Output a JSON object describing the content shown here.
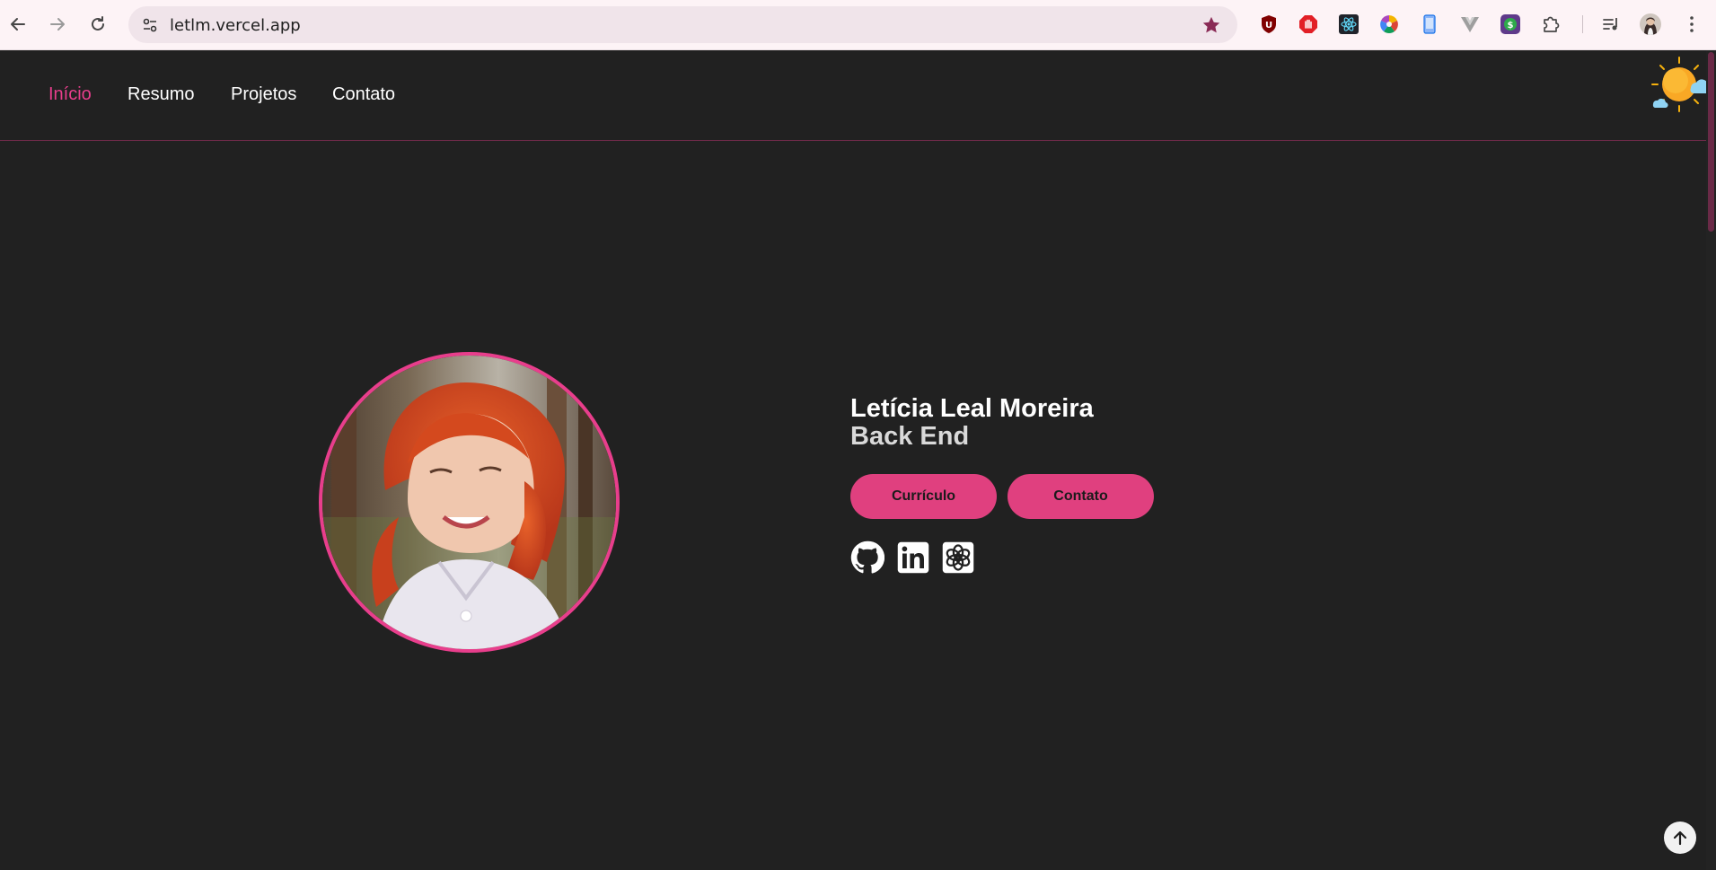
{
  "browser": {
    "url": "letlm.vercel.app",
    "icons": {
      "back": "arrow-left-icon",
      "forward": "arrow-right-icon",
      "reload": "reload-icon",
      "site_info": "tune-icon",
      "bookmark": "star-icon",
      "extensions": [
        "ublock-icon",
        "adblock-icon",
        "react-devtools-icon",
        "color-wheel-icon",
        "phone-icon",
        "vue-devtools-icon",
        "dollar-icon",
        "puzzle-icon"
      ],
      "media": "media-control-icon",
      "profile": "profile-avatar-icon",
      "menu": "kebab-menu-icon"
    }
  },
  "nav": {
    "items": [
      {
        "label": "Início",
        "active": true
      },
      {
        "label": "Resumo",
        "active": false
      },
      {
        "label": "Projetos",
        "active": false
      },
      {
        "label": "Contato",
        "active": false
      }
    ],
    "theme_toggle_icon": "sun-cloud-icon"
  },
  "hero": {
    "name": "Letícia Leal Moreira",
    "role": "Back End",
    "buttons": {
      "resume": "Currículo",
      "contact": "Contato"
    },
    "social_icons": [
      "github-icon",
      "linkedin-icon",
      "openai-icon"
    ]
  },
  "colors": {
    "accent": "#e83e8c",
    "button": "#e0407f",
    "background": "#212121",
    "text": "#ffffff"
  },
  "back_to_top_icon": "arrow-up-icon"
}
